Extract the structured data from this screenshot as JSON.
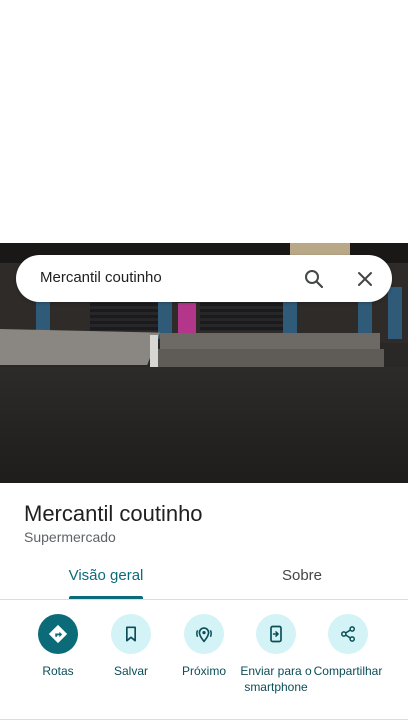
{
  "search": {
    "query": "Mercantil coutinho"
  },
  "place": {
    "name": "Mercantil coutinho",
    "category": "Supermercado"
  },
  "tabs": [
    {
      "label": "Visão geral",
      "selected": true
    },
    {
      "label": "Sobre",
      "selected": false
    }
  ],
  "actions": [
    {
      "label": "Rotas",
      "icon": "directions-icon",
      "primary": true
    },
    {
      "label": "Salvar",
      "icon": "bookmark-icon"
    },
    {
      "label": "Próximo",
      "icon": "nearby-icon"
    },
    {
      "label": "Enviar para o smartphone",
      "icon": "send-to-phone-icon"
    },
    {
      "label": "Compartilhar",
      "icon": "share-icon"
    }
  ],
  "colors": {
    "accent": "#0b6b79",
    "action_bg": "#d3f3f7"
  }
}
